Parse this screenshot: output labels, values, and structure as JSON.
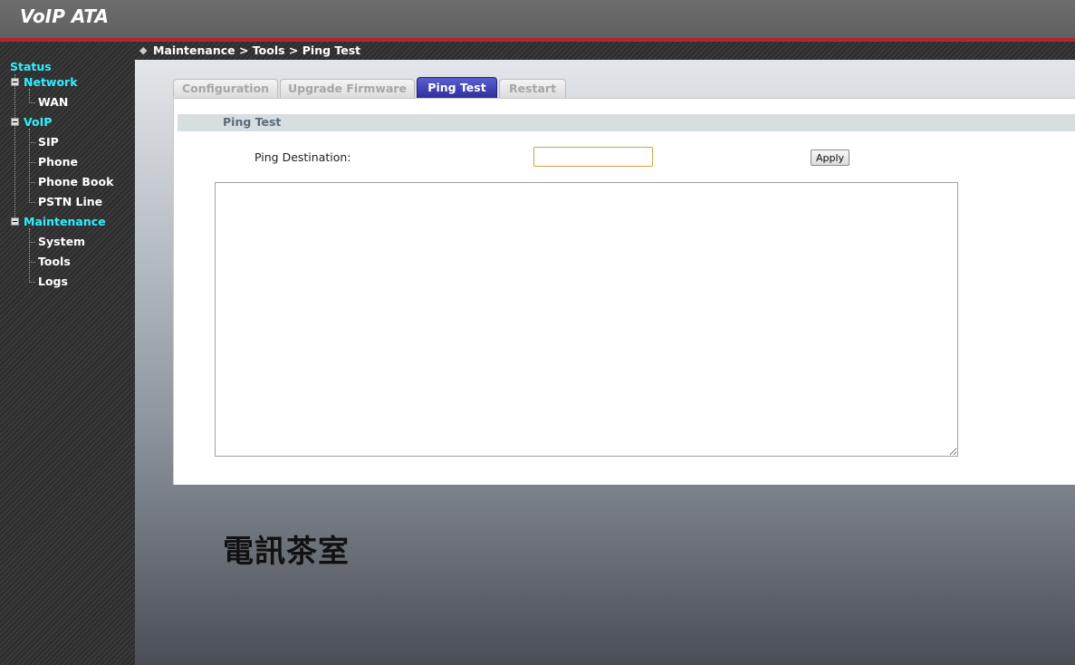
{
  "header": {
    "app_title": "VoIP ATA"
  },
  "breadcrumb": "Maintenance > Tools > Ping Test",
  "sidebar": {
    "status_label": "Status",
    "sections": [
      {
        "label": "Network",
        "items": [
          "WAN"
        ]
      },
      {
        "label": "VoIP",
        "items": [
          "SIP",
          "Phone",
          "Phone Book",
          "PSTN Line"
        ]
      },
      {
        "label": "Maintenance",
        "items": [
          "System",
          "Tools",
          "Logs"
        ]
      }
    ]
  },
  "tabs": [
    {
      "label": "Configuration",
      "active": false
    },
    {
      "label": "Upgrade Firmware",
      "active": false
    },
    {
      "label": "Ping Test",
      "active": true
    },
    {
      "label": "Restart",
      "active": false
    }
  ],
  "panel": {
    "title": "Ping Test",
    "field_label": "Ping Destination:",
    "input_value": "",
    "apply_label": "Apply",
    "result_text": ""
  },
  "watermark": "電訊茶室",
  "colors": {
    "accent_cyan": "#2ff0ff",
    "active_tab": "#2d2f9b",
    "header_red": "#c6242c"
  }
}
